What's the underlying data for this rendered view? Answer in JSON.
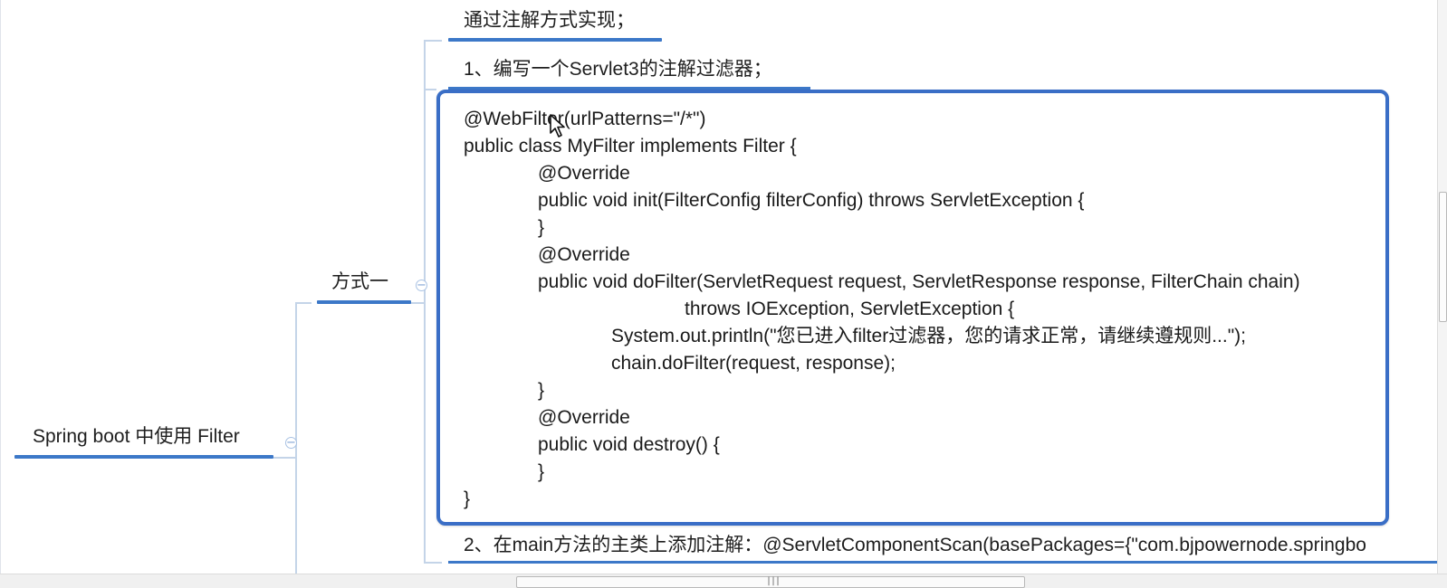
{
  "mindmap": {
    "root": {
      "label": "Spring boot 中使用 Filter",
      "collapse_symbol": "−"
    },
    "method_node": {
      "label": "方式一",
      "collapse_symbol": "−"
    },
    "branch_title": "通过注解方式实现；",
    "step1": "1、编写一个Servlet3的注解过滤器；",
    "step2": "2、在main方法的主类上添加注解：@ServletComponentScan(basePackages={\"com.bjpowernode.springbo",
    "code_lines": [
      "@WebFilter(urlPatterns=\"/*\")",
      "public class MyFilter implements Filter {",
      "@Override",
      "public void init(FilterConfig filterConfig) throws ServletException {",
      "}",
      "@Override",
      "public void doFilter(ServletRequest request, ServletResponse response, FilterChain chain)",
      "throws IOException, ServletException {",
      "System.out.println(\"您已进入filter过滤器，您的请求正常，请继续遵规则...\");",
      "chain.doFilter(request, response);",
      "}",
      "@Override",
      "public void destroy() {",
      "}",
      "}"
    ]
  },
  "scrollbar": {
    "grip": "|||"
  },
  "colors": {
    "accent": "#3c78c8",
    "box_border": "#3a6ec6",
    "connector": "#c4d4e8"
  },
  "icons": {
    "cursor": "mouse-pointer-icon",
    "collapse": "collapse-minus-icon"
  }
}
